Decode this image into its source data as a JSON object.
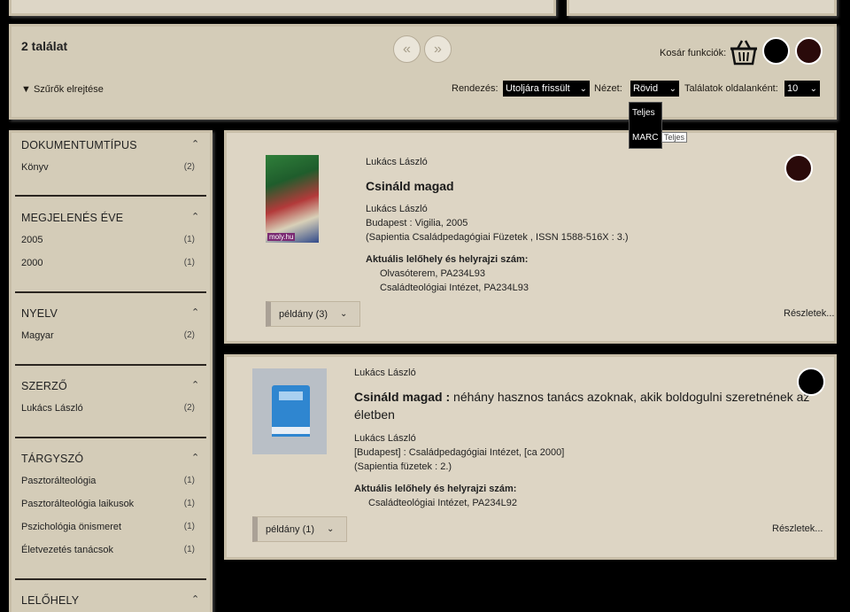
{
  "toolbar": {
    "result_count": "2 találat",
    "prev_icon": "«",
    "next_icon": "»",
    "cart_label": "Kosár funkciók:",
    "filter_toggle": "Szűrők elrejtése",
    "sort_label": "Rendezés:",
    "sort_value": "Utoljára frissült",
    "view_label": "Nézet:",
    "view_value": "Rövid",
    "per_page_label": "Találatok oldalanként:",
    "per_page_value": "10",
    "view_options": [
      "Teljes",
      "MARC"
    ],
    "tooltip": "Teljes",
    "chevron": "❯"
  },
  "sidebar": {
    "facets": [
      {
        "title": "DOKUMENTUMTÍPUS",
        "items": [
          {
            "label": "Könyv",
            "count": "(2)"
          }
        ]
      },
      {
        "title": "MEGJELENÉS ÉVE",
        "items": [
          {
            "label": "2005",
            "count": "(1)"
          },
          {
            "label": "2000",
            "count": "(1)"
          }
        ]
      },
      {
        "title": "NYELV",
        "items": [
          {
            "label": "Magyar",
            "count": "(2)"
          }
        ]
      },
      {
        "title": "SZERZŐ",
        "items": [
          {
            "label": "Lukács László",
            "count": "(2)"
          }
        ]
      },
      {
        "title": "TÁRGYSZÓ",
        "items": [
          {
            "label": "Pasztorálteológia",
            "count": "(1)"
          },
          {
            "label": "Pasztorálteológia laikusok",
            "count": "(1)"
          },
          {
            "label": "Pszichológia önismeret",
            "count": "(1)"
          },
          {
            "label": "Életvezetés tanácsok",
            "count": "(1)"
          }
        ]
      },
      {
        "title": "LELŐHELY",
        "items": []
      }
    ],
    "caret": "⌃"
  },
  "records": [
    {
      "author": "Lukács László",
      "title": "Csináld magad",
      "responsibility": "Lukács László",
      "publication": "Budapest : Vigilia, 2005",
      "series": "(Sapientia Családpedagógiai Füzetek , ISSN 1588-516X : 3.)",
      "holdings_label": "Aktuális lelőhely és helyrajzi szám:",
      "holdings": [
        "Olvasóterem, PA234L93",
        "Családteológiai Intézet, PA234L93"
      ],
      "copies": "példány (3)",
      "details": "Részletek...",
      "cover_label": "moly.hu"
    },
    {
      "author": "Lukács László",
      "title_main": "Csináld magad :",
      "title_rest": " néhány hasznos tanács azoknak, akik boldogulni szeretnének az",
      "title_line2": "életben",
      "responsibility": "Lukács László",
      "publication": "[Budapest] : Családpedagógiai Intézet, [ca 2000]",
      "series": "(Sapientia füzetek : 2.)",
      "holdings_label": "Aktuális lelőhely és helyrajzi szám:",
      "holdings": [
        "Családteológiai Intézet, PA234L92"
      ],
      "copies": "példány (1)",
      "details": "Részletek..."
    }
  ],
  "colors": {
    "panel": "#dcd5c5",
    "border": "#c8bea8",
    "select_bg": "#000000",
    "dot_dark": "#2a0a0a"
  }
}
